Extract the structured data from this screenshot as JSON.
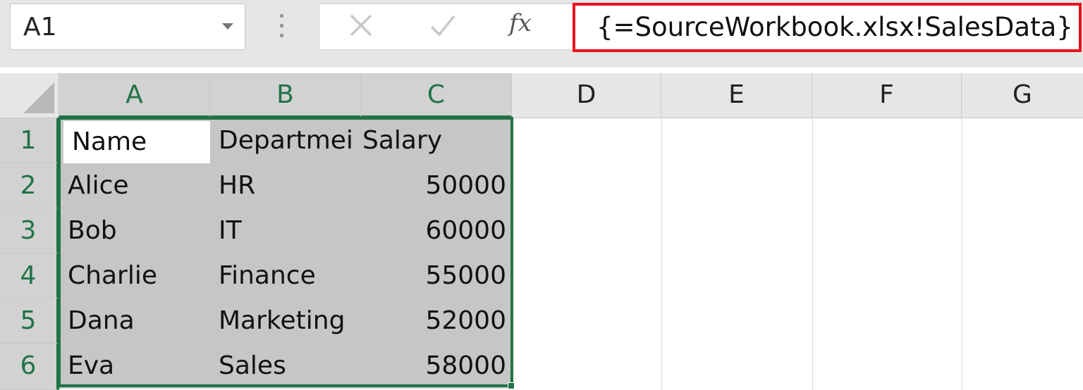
{
  "name_box": {
    "value": "A1"
  },
  "formula_bar": {
    "cancel_label": "✕",
    "enter_label": "✓",
    "fx_label": "fx",
    "formula": "{=SourceWorkbook.xlsx!SalesData}",
    "highlight_color": "#e8121a"
  },
  "columns": [
    "A",
    "B",
    "C",
    "D",
    "E",
    "F",
    "G"
  ],
  "rows": [
    "1",
    "2",
    "3",
    "4",
    "5",
    "6"
  ],
  "table": {
    "header": [
      "Name",
      "Departmei",
      "Salary"
    ],
    "records": [
      [
        "Alice",
        "HR",
        "50000"
      ],
      [
        "Bob",
        "IT",
        "60000"
      ],
      [
        "Charlie",
        "Finance",
        "55000"
      ],
      [
        "Dana",
        "Marketing",
        "52000"
      ],
      [
        "Eva",
        "Sales",
        "58000"
      ]
    ]
  },
  "colors": {
    "accent": "#217346",
    "selection": "#c6c6c6"
  }
}
